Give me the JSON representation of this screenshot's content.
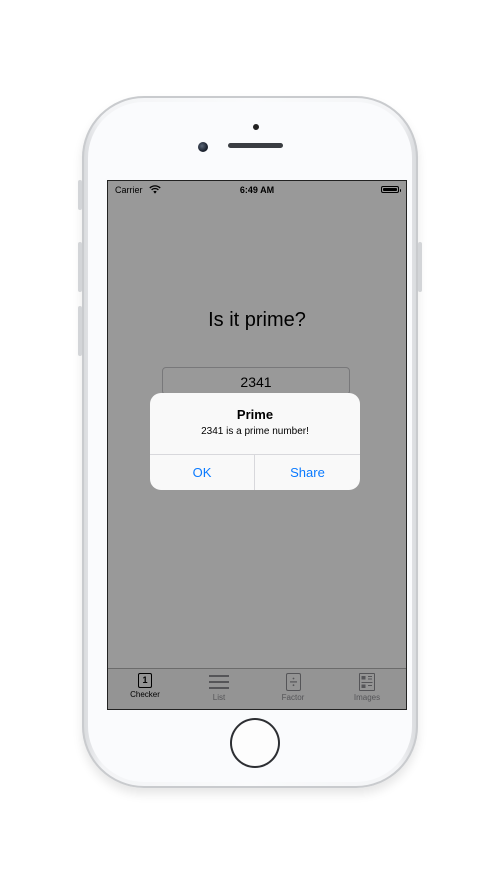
{
  "status_bar": {
    "carrier": "Carrier",
    "time": "6:49 AM"
  },
  "main": {
    "heading": "Is it prime?",
    "number_value": "2341"
  },
  "alert": {
    "title": "Prime",
    "message": "2341 is a prime number!",
    "ok_label": "OK",
    "share_label": "Share"
  },
  "tabbar": {
    "tabs": [
      {
        "label": "Checker",
        "icon": "number-one-icon",
        "icon_text": "1",
        "selected": true
      },
      {
        "label": "List",
        "icon": "list-icon"
      },
      {
        "label": "Factor",
        "icon": "divide-icon"
      },
      {
        "label": "Images",
        "icon": "images-icon"
      }
    ]
  },
  "colors": {
    "accent": "#0a7aff",
    "dim_overlay": "#999999",
    "tab_inactive": "#8e8e93"
  }
}
